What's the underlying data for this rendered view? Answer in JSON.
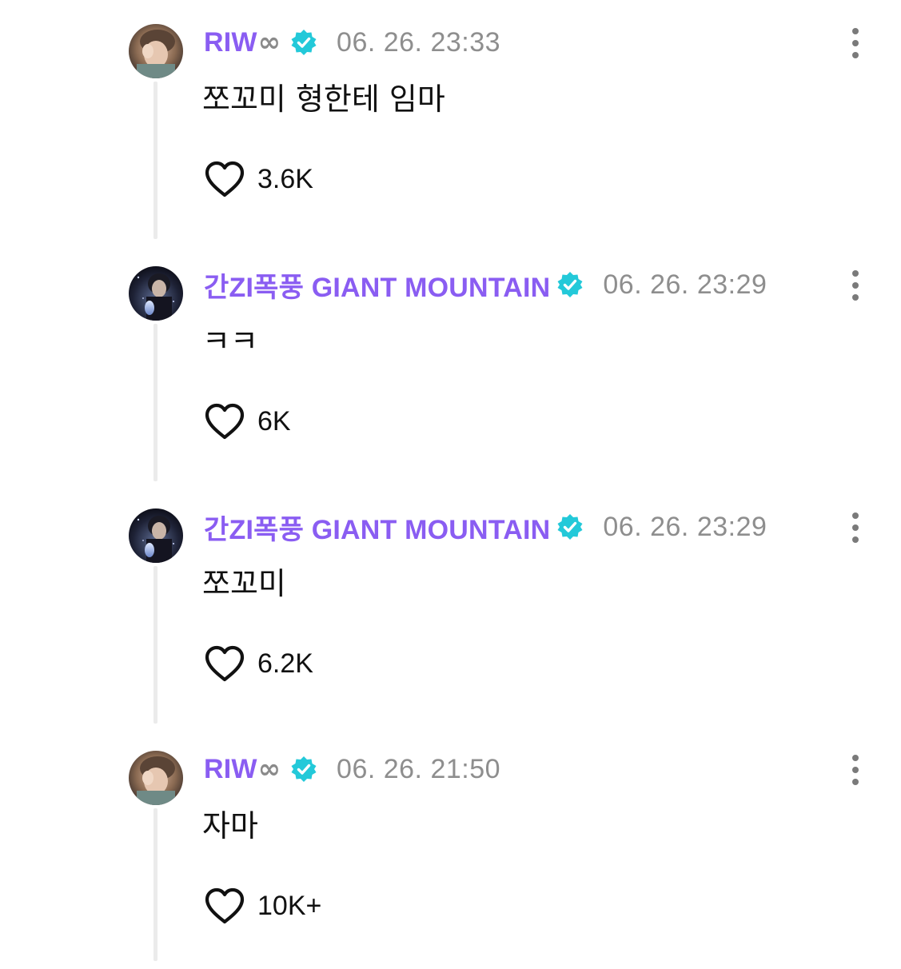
{
  "colors": {
    "name": "#8a5df2",
    "verified_badge": "#23c9d9",
    "timestamp": "#8e8e8e",
    "text": "#111111",
    "thread_line": "#ebebeb"
  },
  "comments": [
    {
      "author": "RIW",
      "author_suffix": "∞",
      "verified": true,
      "avatar": "avatar-riw",
      "timestamp": "06. 26. 23:33",
      "text": "쪼꼬미 형한테 임마",
      "likes": "3.6K"
    },
    {
      "author": "간ZI폭풍 GIANT MOUNTAIN",
      "author_suffix": "",
      "verified": true,
      "avatar": "avatar-giant-mountain",
      "timestamp": "06. 26. 23:29",
      "text": "ㅋㅋ",
      "likes": "6K"
    },
    {
      "author": "간ZI폭풍 GIANT MOUNTAIN",
      "author_suffix": "",
      "verified": true,
      "avatar": "avatar-giant-mountain",
      "timestamp": "06. 26. 23:29",
      "text": "쪼꼬미",
      "likes": "6.2K"
    },
    {
      "author": "RIW",
      "author_suffix": "∞",
      "verified": true,
      "avatar": "avatar-riw",
      "timestamp": "06. 26. 21:50",
      "text": "자마",
      "likes": "10K+"
    }
  ]
}
